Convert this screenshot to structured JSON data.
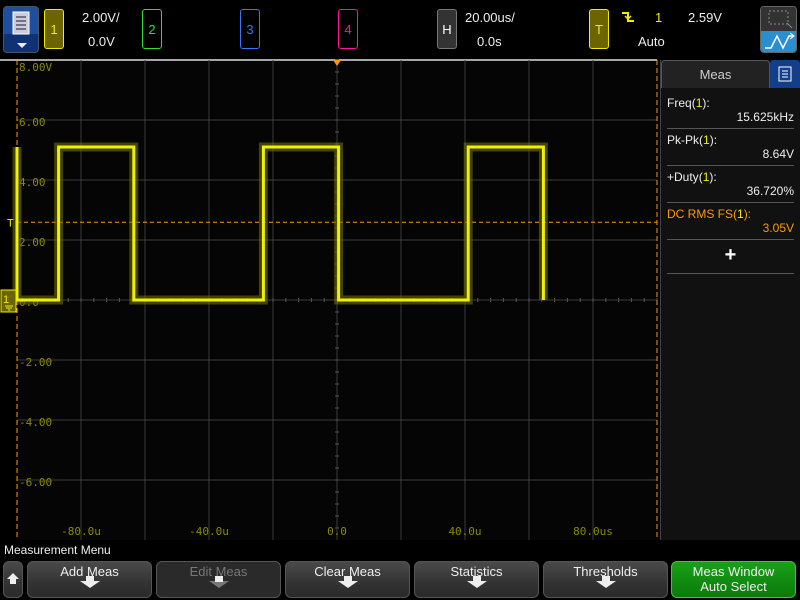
{
  "topbar": {
    "ch1": {
      "label": "1",
      "scale": "2.00V/",
      "offset": "0.0V",
      "color": "#f0f000"
    },
    "ch2": {
      "label": "2",
      "color": "#33dd33"
    },
    "ch3": {
      "label": "3",
      "color": "#3377ff"
    },
    "ch4": {
      "label": "4",
      "color": "#ff1493"
    },
    "horizontal": {
      "label": "H",
      "scale": "20.00us/",
      "position": "0.0s"
    },
    "trigger": {
      "label": "T",
      "source": "1",
      "level": "2.59V",
      "mode": "Auto",
      "slope_icon": "falling-edge"
    }
  },
  "display": {
    "y_labels": [
      "8.00V",
      "6.00",
      "4.00",
      "2.00",
      "0.0",
      "-2.00",
      "-4.00",
      "-6.00"
    ],
    "x_labels": [
      "-80.0u",
      "-40.0u",
      "0.0",
      "40.0u",
      "80.0us"
    ],
    "trigger_marker": "T",
    "ground_marker": "1",
    "waveform": {
      "channel": "1",
      "frequency_khz": 15.625,
      "duty_percent": 36.72,
      "high_v": 5.1,
      "low_v": 0.0,
      "volts_per_div": 2.0,
      "time_per_div_us": 20.0,
      "rising_edge_us": -87.0
    }
  },
  "meas_panel": {
    "title": "Meas",
    "items": [
      {
        "name": "Freq",
        "src": "1",
        "value": "15.625kHz",
        "color": "#eeeeee"
      },
      {
        "name": "Pk-Pk",
        "src": "1",
        "value": "8.64V",
        "color": "#eeeeee"
      },
      {
        "name": "+Duty",
        "src": "1",
        "value": "36.720%",
        "color": "#eeeeee"
      },
      {
        "name": "DC RMS FS",
        "src": "1",
        "value": "3.05V",
        "color": "#ff9900"
      }
    ],
    "add": "+"
  },
  "softkeys": {
    "menu_title": "Measurement Menu",
    "keys": [
      "Add Meas",
      "Edit Meas",
      "Clear Meas",
      "Statistics",
      "Thresholds"
    ],
    "meas_window": {
      "line1": "Meas Window",
      "line2": "Auto Select"
    }
  }
}
